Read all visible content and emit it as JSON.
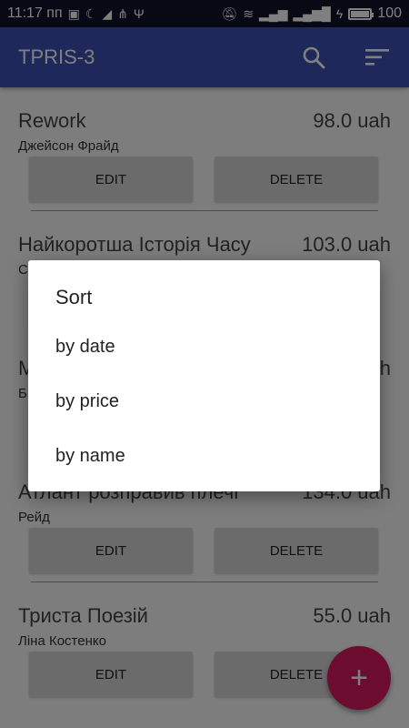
{
  "status_bar": {
    "time": "11:17 пп",
    "battery_level": "100",
    "battery_fraction": 1.0
  },
  "app_bar": {
    "title": "TPRIS-3",
    "search_icon": "search-icon",
    "sort_icon": "sort-icon"
  },
  "books": [
    {
      "name": "Rework",
      "price": "98.0 uah",
      "author": "Джейсон Фрайд"
    },
    {
      "name": "Найкоротша Історія Часу",
      "price": "103.0 uah",
      "author": "С"
    },
    {
      "name": "М",
      "price": "h",
      "author": "Б"
    },
    {
      "name": "Атлант розправив плечі",
      "price": "134.0 uah",
      "author": "Рейд"
    },
    {
      "name": "Триста Поезій",
      "price": "55.0 uah",
      "author": "Ліна Костенко"
    }
  ],
  "buttons": {
    "edit": "EDIT",
    "delete": "DELETE"
  },
  "fab": {
    "label": "+"
  },
  "sort_dialog": {
    "title": "Sort",
    "options": [
      "by date",
      "by price",
      "by name"
    ]
  },
  "colors": {
    "app_bar": "#3f51b5",
    "fab": "#d81b60",
    "status_bar": "#0e1428"
  }
}
